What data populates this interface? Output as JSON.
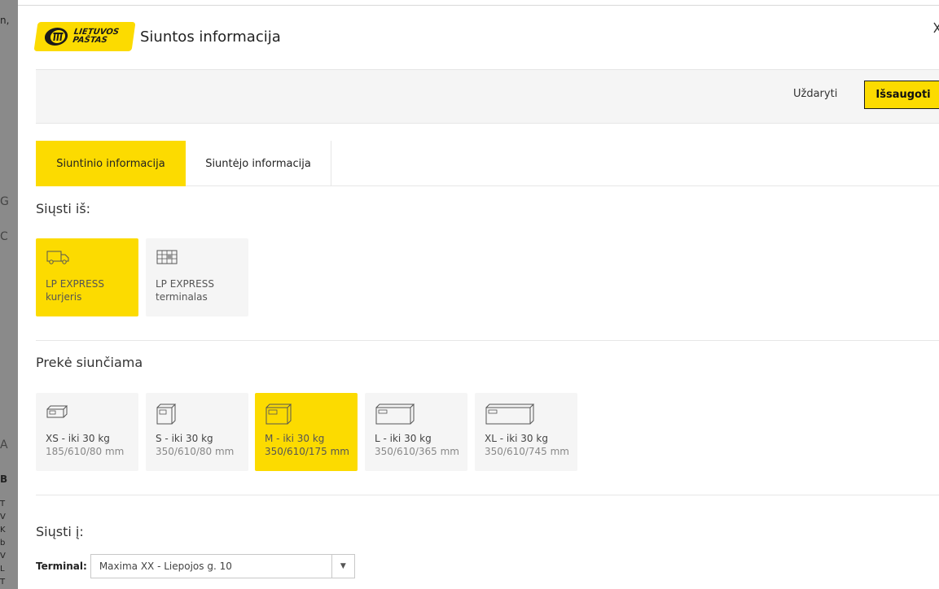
{
  "background": {
    "fragments": [
      "n,",
      "G",
      "C",
      "A",
      "B",
      "T",
      "V",
      "K",
      "b",
      "V",
      "L",
      "T"
    ]
  },
  "header": {
    "logo_line1": "LIETUVOS",
    "logo_line2": "PAŠTAS",
    "title": "Siuntos informacija",
    "close_icon": "close-icon"
  },
  "toolbar": {
    "close_label": "Uždaryti",
    "save_label": "Išsaugoti"
  },
  "tabs": [
    {
      "label": "Siuntinio informacija",
      "active": true
    },
    {
      "label": "Siuntėjo informacija",
      "active": false
    }
  ],
  "send_from": {
    "title": "Siųsti iš:",
    "options": [
      {
        "line1": "LP EXPRESS",
        "line2": "kurjeris",
        "icon": "van-icon",
        "selected": true
      },
      {
        "line1": "LP EXPRESS",
        "line2": "terminalas",
        "icon": "parcel-locker-icon",
        "selected": false
      }
    ]
  },
  "item_sent": {
    "title": "Prekė siunčiama",
    "sizes": [
      {
        "line1": "XS - iki 30 kg",
        "line2": "185/610/80 mm",
        "icon": "box-icon",
        "selected": false
      },
      {
        "line1": "S - iki 30 kg",
        "line2": "350/610/80 mm",
        "icon": "box-icon",
        "selected": false
      },
      {
        "line1": "M - iki 30 kg",
        "line2": "350/610/175 mm",
        "icon": "box-icon",
        "selected": true
      },
      {
        "line1": "L - iki 30 kg",
        "line2": "350/610/365 mm",
        "icon": "box-icon",
        "selected": false
      },
      {
        "line1": "XL - iki 30 kg",
        "line2": "350/610/745 mm",
        "icon": "box-icon",
        "selected": false
      }
    ]
  },
  "send_to": {
    "title": "Siųsti į:",
    "terminal_label": "Terminal:",
    "terminal_value": "Maxima XX - Liepojos g. 10"
  },
  "colors": {
    "accent": "#fcdb00",
    "toolbar_bg": "#f5f5f5",
    "tile_bg": "#f5f5f5"
  }
}
